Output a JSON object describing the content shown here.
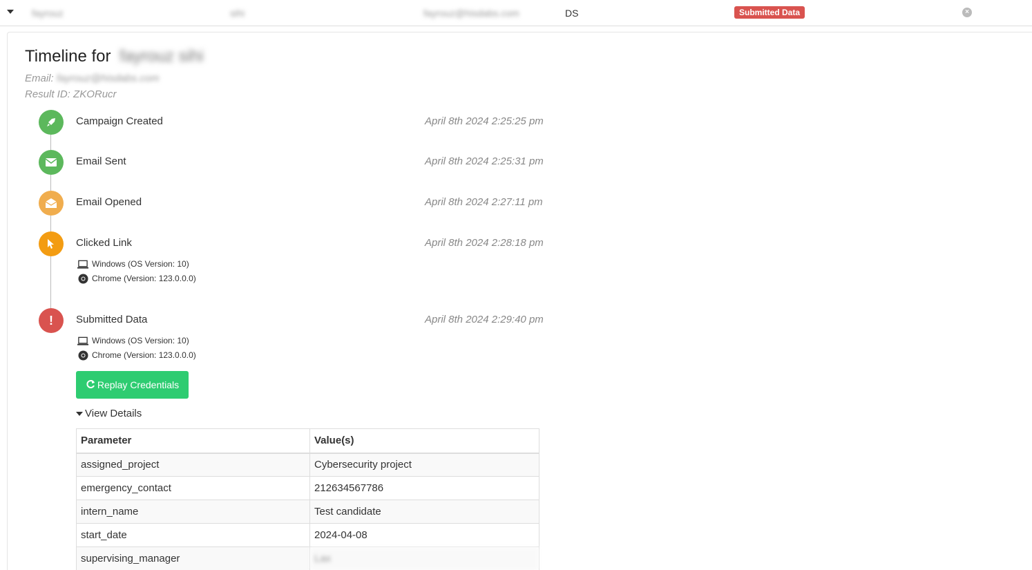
{
  "row": {
    "first_name": "fayrouz",
    "last_name": "sihi",
    "email": "fayrouz@hisdabs.com",
    "position": "DS",
    "status": "Submitted Data",
    "status_color": "#d9534f"
  },
  "timeline": {
    "title_prefix": "Timeline for",
    "title_name": "fayrouz sihi",
    "email_label": "Email:",
    "email_value": "fayrouz@hisdabs.com",
    "result_label": "Result ID:",
    "result_value": "ZKORucr"
  },
  "events": [
    {
      "label": "Campaign Created",
      "time": "April 8th 2024 2:25:25 pm",
      "icon": "rocket-icon",
      "color": "#5cb85c"
    },
    {
      "label": "Email Sent",
      "time": "April 8th 2024 2:25:31 pm",
      "icon": "envelope-icon",
      "color": "#5cb85c"
    },
    {
      "label": "Email Opened",
      "time": "April 8th 2024 2:27:11 pm",
      "icon": "envelope-open-icon",
      "color": "#f0ad4e"
    },
    {
      "label": "Clicked Link",
      "time": "April 8th 2024 2:28:18 pm",
      "icon": "pointer-icon",
      "color": "#f39c12"
    },
    {
      "label": "Submitted Data",
      "time": "April 8th 2024 2:29:40 pm",
      "icon": "exclamation-icon",
      "color": "#d9534f"
    }
  ],
  "clicked_details": {
    "os": "Windows (OS Version: 10)",
    "browser": "Chrome (Version: 123.0.0.0)"
  },
  "submitted_details": {
    "os": "Windows (OS Version: 10)",
    "browser": "Chrome (Version: 123.0.0.0)",
    "replay_label": "Replay Credentials",
    "view_details_label": "View Details"
  },
  "params_table": {
    "headers": [
      "Parameter",
      "Value(s)"
    ],
    "rows": [
      [
        "assigned_project",
        "Cybersecurity project"
      ],
      [
        "emergency_contact",
        "212634567786"
      ],
      [
        "intern_name",
        "Test candidate"
      ],
      [
        "start_date",
        "2024-04-08"
      ],
      [
        "supervising_manager",
        "Lax"
      ]
    ]
  }
}
